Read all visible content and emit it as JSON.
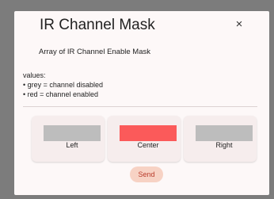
{
  "dialog": {
    "title": "IR Channel Mask",
    "close_icon": "close-icon",
    "close_glyph": "×",
    "description": "Array of IR Channel Enable Mask",
    "values_heading": "values:",
    "values_lines": [
      "• grey = channel disabled",
      "• red = channel enabled"
    ],
    "channels": [
      {
        "label": "Left",
        "enabled": false,
        "color": "#bdbdbd"
      },
      {
        "label": "Center",
        "enabled": true,
        "color": "#fb5a5a"
      },
      {
        "label": "Right",
        "enabled": false,
        "color": "#bdbdbd"
      }
    ],
    "send_label": "Send"
  },
  "colors": {
    "backdrop": "#7c7c7c",
    "dialog_bg": "#fdf8f8",
    "card_bg": "#f6eded",
    "disabled": "#bdbdbd",
    "enabled": "#fb5a5a",
    "send_bg": "#f7d2c4",
    "send_text": "#b93a2a"
  }
}
